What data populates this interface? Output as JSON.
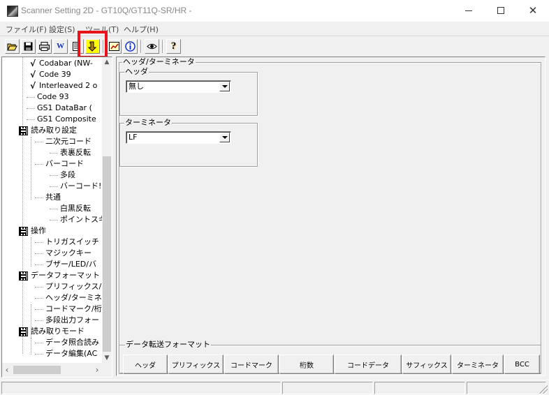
{
  "window": {
    "title": "Scanner Setting 2D - GT10Q/GT11Q-SR/HR -",
    "minimize_label": "",
    "maximize_label": "",
    "close_label": "✕"
  },
  "menu": [
    {
      "label": "ファイル(F)"
    },
    {
      "label": "設定(S)"
    },
    {
      "label": "ツール(T)"
    },
    {
      "label": "ヘルプ(H)"
    }
  ],
  "toolbar": {
    "buttons": [
      {
        "icon": "open-folder-icon",
        "glyph": "📂"
      },
      {
        "icon": "save-disk-icon",
        "glyph": "■"
      },
      {
        "icon": "print-icon",
        "glyph": "🖶"
      },
      {
        "icon": "word-icon",
        "glyph": "W"
      },
      {
        "icon": "scanner-read-icon",
        "glyph": "▤"
      },
      {
        "icon": "download-to-scanner-icon",
        "glyph": "↴"
      },
      {
        "icon": "chart-icon",
        "glyph": "▦"
      },
      {
        "icon": "info-icon",
        "glyph": "ⓘ"
      },
      {
        "icon": "view-eye-icon",
        "glyph": "👁"
      },
      {
        "icon": "help-question-icon",
        "glyph": "?"
      }
    ],
    "highlight_color": "#e8141c"
  },
  "tree": {
    "items": [
      {
        "label": "Codabar (NW-",
        "check": "√"
      },
      {
        "label": "Code 39",
        "check": "√"
      },
      {
        "label": "Interleaved 2 o",
        "check": "√"
      },
      {
        "label": "Code 93",
        "check": ""
      },
      {
        "label": "GS1 DataBar (",
        "check": ""
      },
      {
        "label": "GS1 Composite",
        "check": ""
      },
      {
        "label": "読み取り設定",
        "icon": "qr-folder-icon"
      },
      {
        "label": "二次元コード"
      },
      {
        "label": "表裏反転"
      },
      {
        "label": "バーコード"
      },
      {
        "label": "多段"
      },
      {
        "label": "バーコード!"
      },
      {
        "label": "共通"
      },
      {
        "label": "白黒反転"
      },
      {
        "label": "ポイントスキ"
      },
      {
        "label": "操作",
        "icon": "qr-folder-icon"
      },
      {
        "label": "トリガスイッチ"
      },
      {
        "label": "マジックキー"
      },
      {
        "label": "ブザー/LED/バ"
      },
      {
        "label": "データフォーマット",
        "icon": "qr-folder-icon"
      },
      {
        "label": "プリフィックス/"
      },
      {
        "label": "ヘッダ/ターミネ"
      },
      {
        "label": "コードマーク/桁"
      },
      {
        "label": "多段出力フォー"
      },
      {
        "label": "読み取りモード",
        "icon": "qr-folder-icon"
      },
      {
        "label": "データ照合読み"
      },
      {
        "label": "データ編集(AC"
      }
    ]
  },
  "panel": {
    "title": "ヘッダ/ターミネータ",
    "header": {
      "label": "ヘッダ",
      "value": "無し"
    },
    "terminator": {
      "label": "ターミネータ",
      "value": "LF"
    }
  },
  "transfer_format": {
    "title": "データ転送フォーマット",
    "cells": [
      "ヘッダ",
      "プリフィックス",
      "コードマーク",
      "桁数",
      "コードデータ",
      "サフィックス",
      "ターミネータ",
      "BCC"
    ]
  }
}
